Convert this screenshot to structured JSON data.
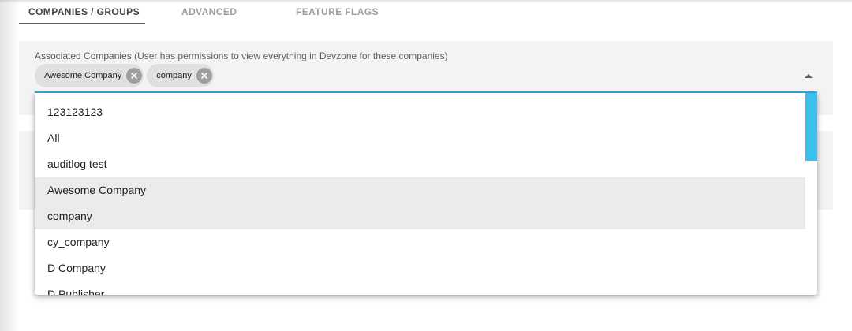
{
  "tabs": [
    {
      "label": "COMPANIES / GROUPS",
      "active": true
    },
    {
      "label": "ADVANCED",
      "active": false
    },
    {
      "label": "FEATURE FLAGS",
      "active": false
    }
  ],
  "field": {
    "label_strong": "Associated Companies",
    "label_note": " (User has permissions to view everything in Devzone for these companies)",
    "chips": [
      "Awesome Company",
      "company"
    ],
    "expanded": true
  },
  "dropdown": {
    "options": [
      {
        "label": "123123123",
        "selected": false
      },
      {
        "label": "All",
        "selected": false
      },
      {
        "label": "auditlog test",
        "selected": false
      },
      {
        "label": "Awesome Company",
        "selected": true
      },
      {
        "label": "company",
        "selected": true
      },
      {
        "label": "cy_company",
        "selected": false
      },
      {
        "label": "D Company",
        "selected": false
      },
      {
        "label": "D Publisher",
        "selected": false
      }
    ]
  },
  "colors": {
    "accent": "#3ea8d8",
    "scrollbar": "#39c0ed",
    "chip_bg": "#e0e0e0",
    "selected_bg": "#ebebeb"
  },
  "icons": {
    "chip_remove": "close-circle-icon",
    "dropdown_toggle": "caret-up-icon"
  }
}
